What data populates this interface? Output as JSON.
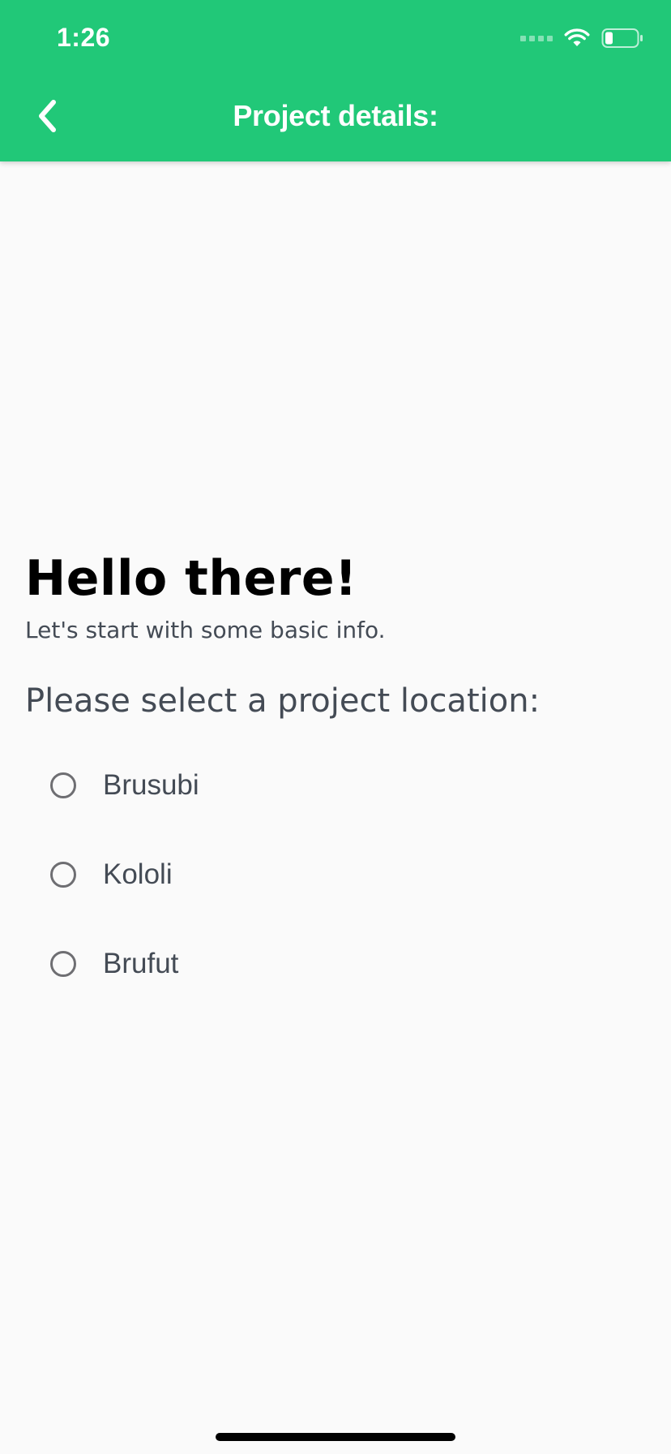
{
  "status_bar": {
    "time": "1:26"
  },
  "nav": {
    "title": "Project details:",
    "back_icon": "chevron-left-icon"
  },
  "main": {
    "greeting": "Hello there!",
    "subtitle": "Let's start with some basic info.",
    "question": "Please select a project location:",
    "options": [
      {
        "label": "Brusubi",
        "selected": false
      },
      {
        "label": "Kololi",
        "selected": false
      },
      {
        "label": "Brufut",
        "selected": false
      }
    ]
  },
  "colors": {
    "accent": "#21c878",
    "background": "#fafafa",
    "text_primary": "#000000",
    "text_secondary": "#444b55",
    "radio_border": "#6e6e72"
  }
}
